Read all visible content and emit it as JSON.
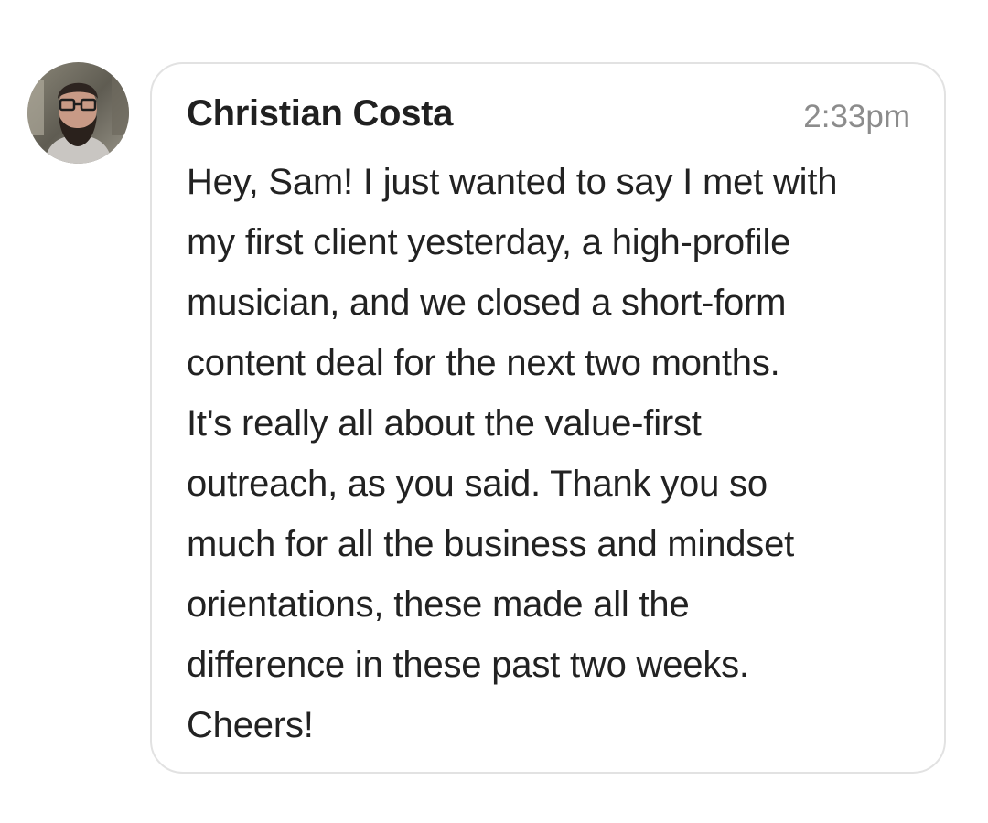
{
  "message": {
    "avatar_icon": "user-avatar-photo",
    "sender": "Christian Costa",
    "timestamp": "2:33pm",
    "lines": [
      "Hey, Sam! I just wanted to say I met with",
      "my first client yesterday, a high-profile",
      "musician, and we closed a short-form",
      "content deal for the next two months.",
      "It's really all about the value-first",
      "outreach, as you said. Thank you so",
      "much for all the business and mindset",
      "orientations, these made all the",
      "difference in these past two weeks.",
      "Cheers!"
    ]
  },
  "colors": {
    "bubble_border": "#e2e2e2",
    "sender_text": "#202020",
    "timestamp_text": "#8c8c8c",
    "body_text": "#222222"
  }
}
